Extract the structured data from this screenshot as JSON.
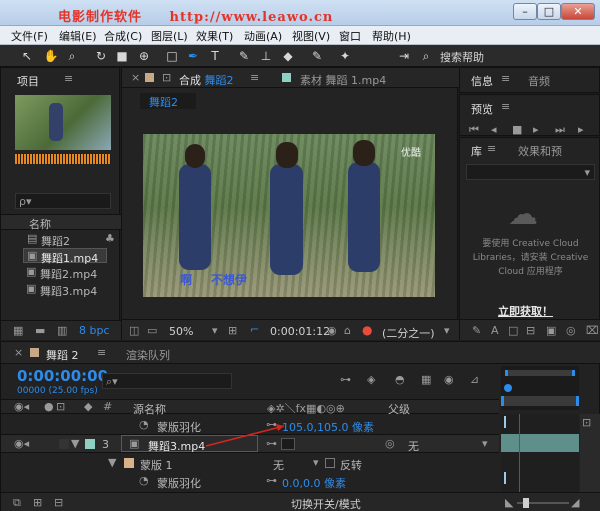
{
  "watermark": {
    "brand": "电影制作软件",
    "url": "http://www.leawo.cn"
  },
  "window_buttons": {
    "minimize": "–",
    "maximize": "□",
    "close": "✕"
  },
  "menu": [
    "文件(F)",
    "编辑(E)",
    "合成(C)",
    "图层(L)",
    "效果(T)",
    "动画(A)",
    "视图(V)",
    "窗口",
    "帮助(H)"
  ],
  "toolbar": {
    "search_label": "搜索帮助"
  },
  "project_panel": {
    "tab": "项目",
    "column_name": "名称",
    "items": [
      "舞蹈2",
      "舞蹈1.mp4",
      "舞蹈2.mp4",
      "舞蹈3.mp4"
    ],
    "bit_depth": "8 bpc",
    "search_placeholder": "ρ▾"
  },
  "comp_panel": {
    "tab_prefix": "合成",
    "tab_comp": "舞蹈2",
    "footage_tab_prefix": "素材",
    "footage_tab_name": "舞蹈 1.mp4",
    "breadcrumb": "舞蹈2",
    "video_overlay_tl": "优酷",
    "subtitle_1": "啊",
    "subtitle_2": "不想伊",
    "zoom": "50%",
    "timecode": "0:00:01:12",
    "resolution": "(二分之一)"
  },
  "right_panels": {
    "info_tab": "信息",
    "audio_tab": "音频",
    "preview_tab": "预览",
    "library_tab": "库",
    "effects_tab": "效果和预",
    "cc_message": "要使用 Creative Cloud Libraries，请安装 Creative Cloud 应用程序",
    "cc_link": "立即获取！"
  },
  "timeline": {
    "tab_comp": "舞蹈 2",
    "tab_render": "渲染队列",
    "timecode": "0:00:00:00",
    "frames_fps": "00000 (25.00 fps)",
    "col_source": "源名称",
    "col_parent": "父级",
    "layers": [
      {
        "prop": "蒙版羽化",
        "value": "105.0,105.0 像素"
      },
      {
        "num": "3",
        "name": "舞蹈3.mp4",
        "parent": "无"
      },
      {
        "prop": "蒙版 1",
        "mode": "无",
        "invert": "反转"
      },
      {
        "prop": "蒙版羽化",
        "value": "0.0,0.0 像素"
      }
    ],
    "footer": "切换开关/模式"
  },
  "colors": {
    "accent": "#2d8ceb",
    "watermark": "#e3342b",
    "annotation": "#d3261f",
    "playhead": "#d3261f"
  }
}
